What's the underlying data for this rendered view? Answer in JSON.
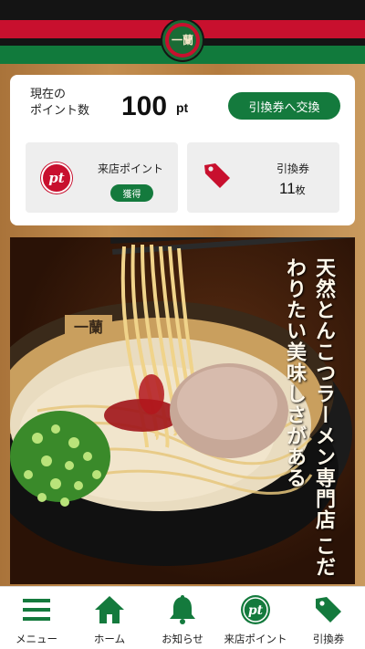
{
  "header": {
    "logo_text": "一蘭"
  },
  "points": {
    "label_line1": "現在の",
    "label_line2": "ポイント数",
    "value": "100",
    "unit": "pt",
    "exchange_button": "引換券へ交換"
  },
  "visit": {
    "icon_text": "pt",
    "label": "来店ポイント",
    "get_button": "獲得"
  },
  "coupon": {
    "label": "引換券",
    "count": "11",
    "unit": "枚"
  },
  "banner": {
    "line1": "天然とんこつラーメン専門店",
    "line2": "こだわりたい美味しさがある"
  },
  "nav": {
    "items": [
      {
        "label": "メニュー",
        "icon": "menu-icon"
      },
      {
        "label": "ホーム",
        "icon": "home-icon"
      },
      {
        "label": "お知らせ",
        "icon": "bell-icon"
      },
      {
        "label": "来店ポイント",
        "icon": "pt-icon"
      },
      {
        "label": "引換券",
        "icon": "tag-icon"
      }
    ]
  },
  "colors": {
    "brand_green": "#147a3d",
    "brand_red": "#c8102e"
  }
}
